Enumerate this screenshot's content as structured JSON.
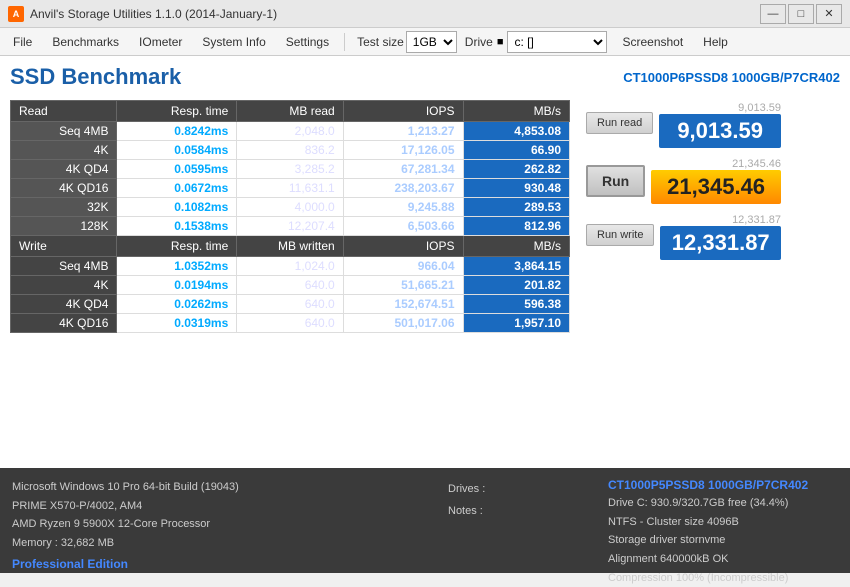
{
  "titlebar": {
    "icon": "A",
    "title": "Anvil's Storage Utilities 1.1.0 (2014-January-1)",
    "controls": [
      "—",
      "□",
      "✕"
    ]
  },
  "menubar": {
    "items": [
      "File",
      "Benchmarks",
      "IOmeter",
      "System Info",
      "Settings"
    ],
    "test_size_label": "Test size",
    "test_size_value": "1GB",
    "drive_label": "Drive",
    "drive_icon": "■",
    "drive_value": "c: []",
    "screenshot_label": "Screenshot",
    "help_label": "Help"
  },
  "header": {
    "title": "SSD Benchmark",
    "drive_id": "CT1000P6PSSD8 1000GB/P7CR402"
  },
  "table": {
    "read_headers": [
      "Read",
      "Resp. time",
      "MB read",
      "IOPS",
      "MB/s"
    ],
    "read_rows": [
      {
        "label": "Seq 4MB",
        "resp": "0.8242ms",
        "mb": "2,048.0",
        "iops": "1,213.27",
        "mbs": "4,853.08"
      },
      {
        "label": "4K",
        "resp": "0.0584ms",
        "mb": "836.2",
        "iops": "17,126.05",
        "mbs": "66.90"
      },
      {
        "label": "4K QD4",
        "resp": "0.0595ms",
        "mb": "3,285.2",
        "iops": "67,281.34",
        "mbs": "262.82"
      },
      {
        "label": "4K QD16",
        "resp": "0.0672ms",
        "mb": "11,631.1",
        "iops": "238,203.67",
        "mbs": "930.48"
      },
      {
        "label": "32K",
        "resp": "0.1082ms",
        "mb": "4,000.0",
        "iops": "9,245.88",
        "mbs": "289.53"
      },
      {
        "label": "128K",
        "resp": "0.1538ms",
        "mb": "12,207.4",
        "iops": "6,503.66",
        "mbs": "812.96"
      }
    ],
    "write_headers": [
      "Write",
      "Resp. time",
      "MB written",
      "IOPS",
      "MB/s"
    ],
    "write_rows": [
      {
        "label": "Seq 4MB",
        "resp": "1.0352ms",
        "mb": "1,024.0",
        "iops": "966.04",
        "mbs": "3,864.15"
      },
      {
        "label": "4K",
        "resp": "0.0194ms",
        "mb": "640.0",
        "iops": "51,665.21",
        "mbs": "201.82"
      },
      {
        "label": "4K QD4",
        "resp": "0.0262ms",
        "mb": "640.0",
        "iops": "152,674.51",
        "mbs": "596.38"
      },
      {
        "label": "4K QD16",
        "resp": "0.0319ms",
        "mb": "640.0",
        "iops": "501,017.06",
        "mbs": "1,957.10"
      }
    ]
  },
  "scores": {
    "run_read_label": "Run read",
    "run_read_score_small": "9,013.59",
    "run_read_score": "9,013.59",
    "run_label": "Run",
    "run_score_small": "21,345.46",
    "run_score": "21,345.46",
    "run_write_label": "Run write",
    "run_write_score_small": "12,331.87",
    "run_write_score": "12,331.87"
  },
  "bottom": {
    "left": {
      "os": "Microsoft Windows 10 Pro 64-bit Build (19043)",
      "mb": "PRIME X570-P/4002, AM4",
      "cpu": "AMD Ryzen 9 5900X 12-Core Processor",
      "mem": "Memory : 32,682 MB",
      "edition": "Professional Edition"
    },
    "center": {
      "drives_label": "Drives :",
      "notes_label": "Notes :"
    },
    "right": {
      "title": "CT1000P5PSSD8 1000GB/P7CR402",
      "drive_c": "Drive C: 930.9/320.7GB free (34.4%)",
      "ntfs": "NTFS - Cluster size 4096B",
      "storage_driver": "Storage driver  stornvme",
      "alignment": "Alignment 640000kB OK",
      "compression": "Compression 100% (Incompressible)"
    }
  }
}
